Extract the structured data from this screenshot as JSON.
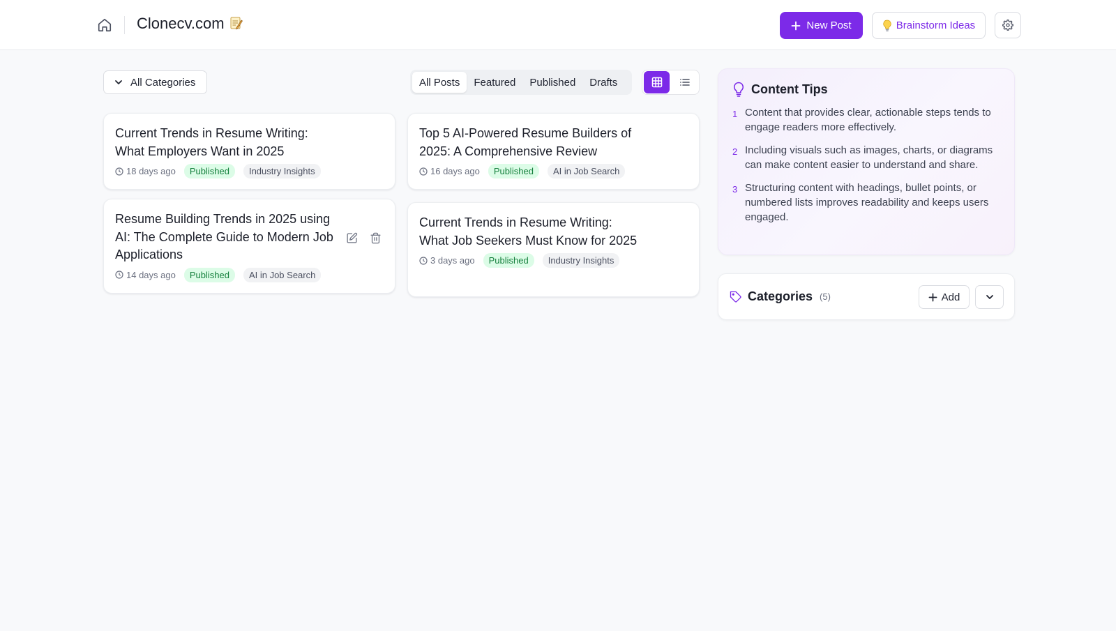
{
  "header": {
    "title": "Clonecv.com",
    "new_post_label": "New Post",
    "brainstorm_label": "Brainstorm Ideas"
  },
  "toolbar": {
    "category_filter": "All Categories",
    "tabs": [
      {
        "label": "All Posts",
        "active": true
      },
      {
        "label": "Featured",
        "active": false
      },
      {
        "label": "Published",
        "active": false
      },
      {
        "label": "Drafts",
        "active": false
      }
    ],
    "view_mode": "grid"
  },
  "posts": [
    {
      "title": "Current Trends in Resume Writing: What Employers Want in 2025",
      "time": "18 days ago",
      "status": "Published",
      "category": "Industry Insights"
    },
    {
      "title": "Top 5 AI-Powered Resume Builders of 2025: A Comprehensive Review",
      "time": "16 days ago",
      "status": "Published",
      "category": "AI in Job Search"
    },
    {
      "title": "Resume Building Trends in 2025 using AI: The Complete Guide to Modern Job Applications",
      "time": "14 days ago",
      "status": "Published",
      "category": "AI in Job Search"
    },
    {
      "title": "Current Trends in Resume Writing: What Job Seekers Must Know for 2025",
      "time": "3 days ago",
      "status": "Published",
      "category": "Industry Insights"
    }
  ],
  "tips": {
    "title": "Content Tips",
    "items": [
      {
        "num": "1",
        "text": "Content that provides clear, actionable steps tends to engage readers more effectively."
      },
      {
        "num": "2",
        "text": "Including visuals such as images, charts, or diagrams can make content easier to understand and share."
      },
      {
        "num": "3",
        "text": "Structuring content with headings, bullet points, or numbered lists improves readability and keeps users engaged."
      }
    ]
  },
  "categories": {
    "title": "Categories",
    "count": "(5)",
    "add_label": "Add"
  },
  "colors": {
    "accent": "#7c2ae8",
    "published_bg": "#dcfce7",
    "published_text": "#15803d",
    "page_bg": "#f8f9fb"
  },
  "icons": {
    "home": "home-icon",
    "plus": "plus-icon",
    "bulb": "lightbulb-icon",
    "gear": "gear-icon",
    "chevron": "chevron-down-icon",
    "grid": "grid-icon",
    "list": "list-icon",
    "clock": "clock-icon",
    "edit": "edit-icon",
    "trash": "trash-icon",
    "tag": "tag-icon"
  }
}
